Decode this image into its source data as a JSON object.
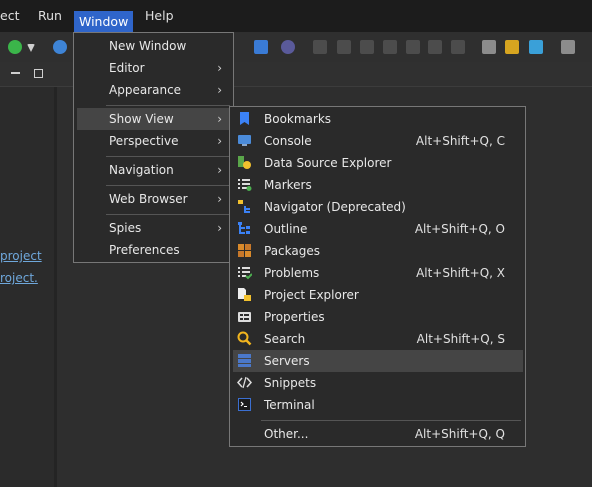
{
  "menubar": {
    "items": [
      {
        "label": "ect"
      },
      {
        "label": "Run"
      },
      {
        "label": "Window"
      },
      {
        "label": "Help"
      }
    ]
  },
  "left_links": [
    "project",
    "roject."
  ],
  "window_menu": {
    "items": [
      {
        "label": "New Window",
        "submenu": false
      },
      {
        "label": "Editor",
        "submenu": true
      },
      {
        "label": "Appearance",
        "submenu": true
      },
      {
        "label": "Show View",
        "submenu": true,
        "highlighted": true
      },
      {
        "label": "Perspective",
        "submenu": true
      },
      {
        "label": "Navigation",
        "submenu": true
      },
      {
        "label": "Web Browser",
        "submenu": true
      },
      {
        "label": "Spies",
        "submenu": true
      },
      {
        "label": "Preferences",
        "submenu": false
      }
    ]
  },
  "show_view_menu": {
    "items": [
      {
        "label": "Bookmarks",
        "shortcut": "",
        "icon": "bookmark-icon"
      },
      {
        "label": "Console",
        "shortcut": "Alt+Shift+Q, C",
        "icon": "console-icon"
      },
      {
        "label": "Data Source Explorer",
        "shortcut": "",
        "icon": "data-source-icon"
      },
      {
        "label": "Markers",
        "shortcut": "",
        "icon": "markers-icon"
      },
      {
        "label": "Navigator (Deprecated)",
        "shortcut": "",
        "icon": "navigator-icon"
      },
      {
        "label": "Outline",
        "shortcut": "Alt+Shift+Q, O",
        "icon": "outline-icon"
      },
      {
        "label": "Packages",
        "shortcut": "",
        "icon": "packages-icon"
      },
      {
        "label": "Problems",
        "shortcut": "Alt+Shift+Q, X",
        "icon": "problems-icon"
      },
      {
        "label": "Project Explorer",
        "shortcut": "",
        "icon": "project-explorer-icon"
      },
      {
        "label": "Properties",
        "shortcut": "",
        "icon": "properties-icon"
      },
      {
        "label": "Search",
        "shortcut": "Alt+Shift+Q, S",
        "icon": "search-icon"
      },
      {
        "label": "Servers",
        "shortcut": "",
        "icon": "servers-icon",
        "highlighted": true
      },
      {
        "label": "Snippets",
        "shortcut": "",
        "icon": "snippets-icon"
      },
      {
        "label": "Terminal",
        "shortcut": "",
        "icon": "terminal-icon"
      },
      {
        "label": "Other...",
        "shortcut": "Alt+Shift+Q, Q",
        "icon": ""
      }
    ]
  },
  "colors": {
    "menu_active": "#2f65ca",
    "highlight_row": "#454545",
    "link": "#6fa8dc"
  }
}
